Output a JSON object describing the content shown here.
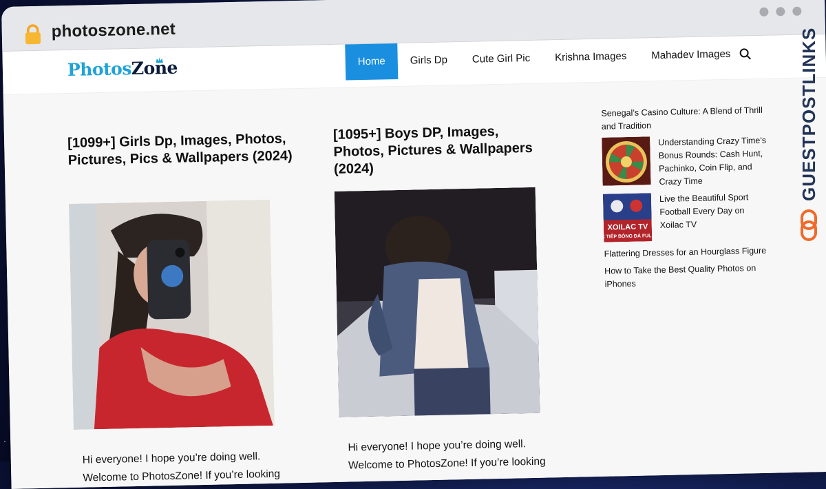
{
  "browser": {
    "url": "photoszone.net"
  },
  "site": {
    "logo_part1": "Photos",
    "logo_part2": "Zone",
    "nav": [
      {
        "label": "Home",
        "active": true
      },
      {
        "label": "Girls Dp"
      },
      {
        "label": "Cute Girl Pic"
      },
      {
        "label": "Krishna Images"
      },
      {
        "label": "Mahadev Images"
      }
    ]
  },
  "posts": [
    {
      "title": "[1099+] Girls Dp, Images, Photos, Pictures, Pics & Wallpapers (2024)",
      "excerpt_line1": "Hi everyone! I hope you’re doing well.",
      "excerpt_line2": "Welcome to PhotosZone! If you’re looking"
    },
    {
      "title": "[1095+] Boys DP, Images, Photos, Pictures & Wallpapers (2024)",
      "excerpt_line1": "Hi everyone! I hope you’re doing well.",
      "excerpt_line2": "Welcome to PhotosZone! If you’re looking"
    }
  ],
  "sidebar": {
    "item1": "Senegal’s Casino Culture: A Blend of Thrill and Tradition",
    "item2": "Understanding Crazy Time’s Bonus Rounds: Cash Hunt, Pachinko, Coin Flip, and Crazy Time",
    "item3": "Live the Beautiful Sport Football Every Day on Xoilac TV",
    "item3_thumb_text": "XOILAC TV",
    "item3_thumb_sub": "C TIẾP BÓNG ĐÁ FULL",
    "item4": "Flattering Dresses for an Hourglass Figure",
    "item5": "How to Take the Best Quality Photos on iPhones"
  },
  "watermark": {
    "text": "GUESTPOSTLINKS"
  },
  "colors": {
    "nav_active": "#1a8fe0",
    "logo_blue": "#1fa3d8",
    "watermark_orange": "#f06a2a",
    "watermark_navy": "#223457"
  }
}
